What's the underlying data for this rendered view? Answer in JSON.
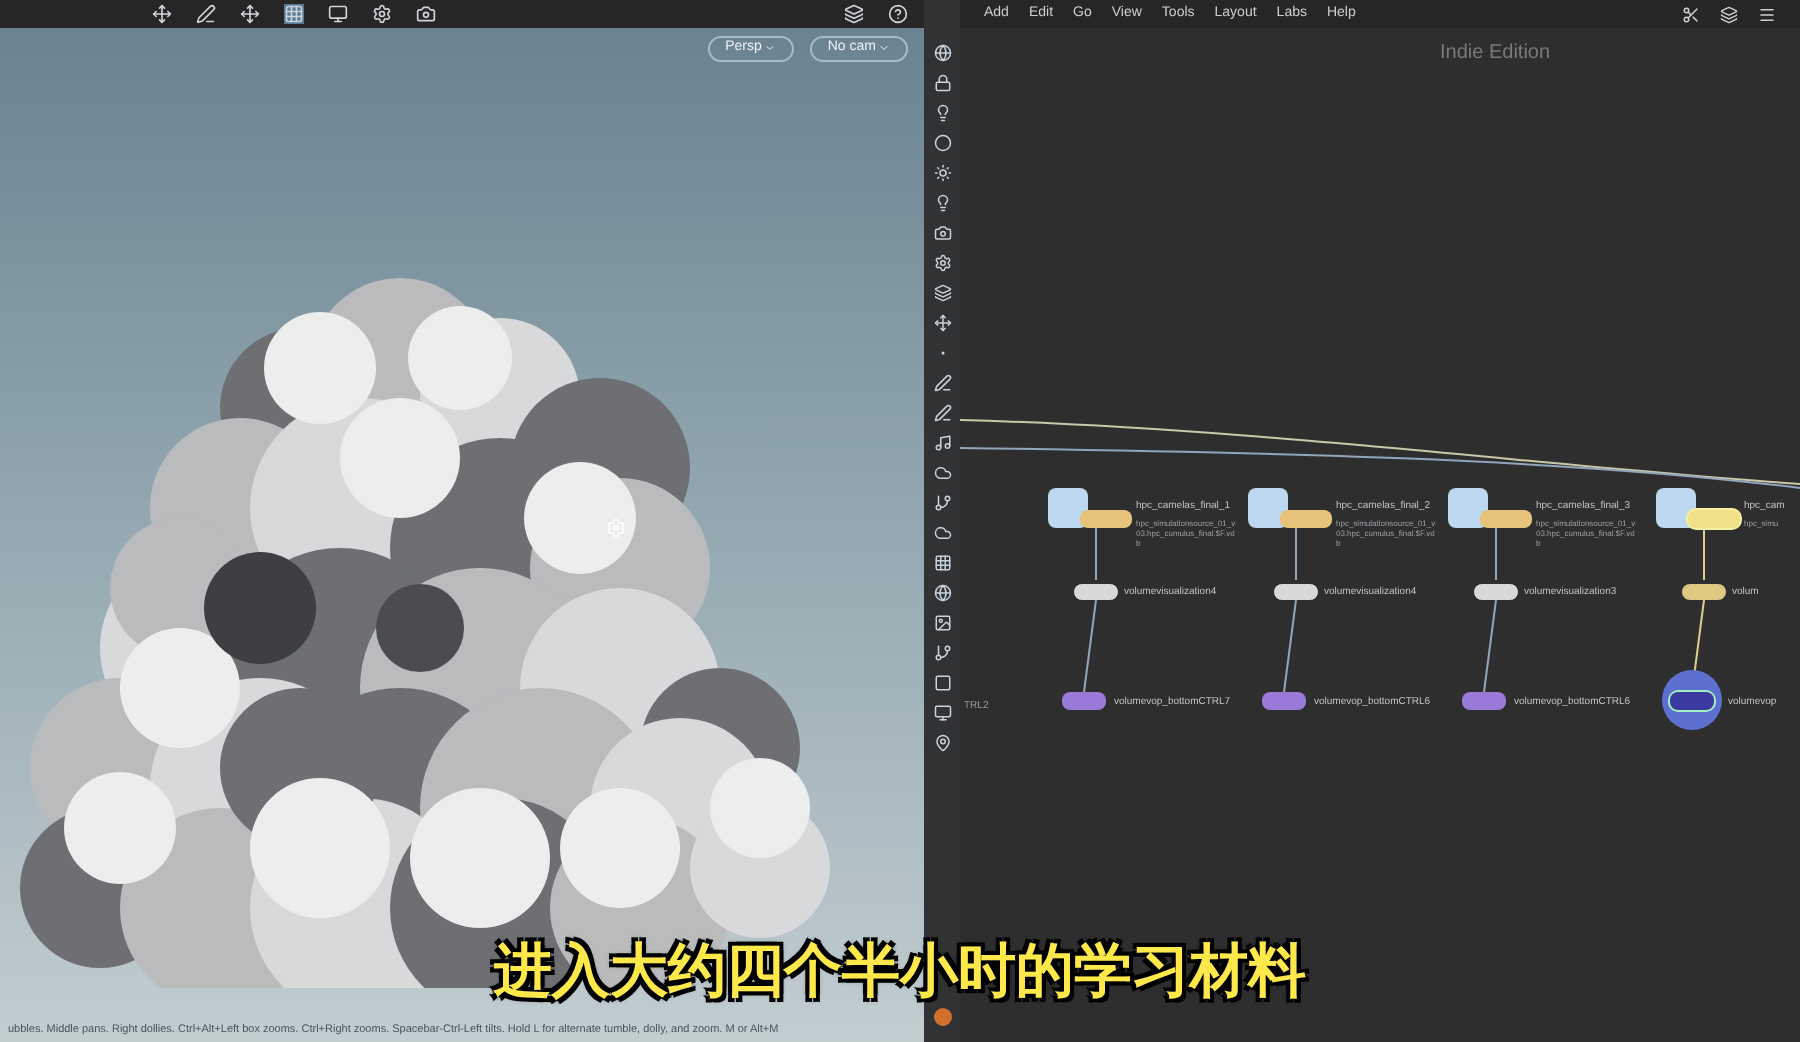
{
  "viewport": {
    "view_menus": [
      "Persp",
      "No cam"
    ],
    "status_bar": "ubbles. Middle pans. Right dollies. Ctrl+Alt+Left box zooms. Ctrl+Right zooms. Spacebar-Ctrl-Left tilts. Hold L for alternate tumble, dolly, and zoom.    M or Alt+M"
  },
  "network": {
    "menu": [
      "Add",
      "Edit",
      "Go",
      "View",
      "Tools",
      "Layout",
      "Labs",
      "Help"
    ],
    "edition": "Indie Edition",
    "side_label": "TRL2",
    "columns": [
      {
        "file": "hpc_camelas_final_1",
        "file_path": "hpc_simulationsource_01_v03.hpc_cumulus_final.$F.vdb",
        "visualize": "volumevisualization4",
        "vop": "volumevop_bottomCTRL7",
        "selected": false
      },
      {
        "file": "hpc_camelas_final_2",
        "file_path": "hpc_simulationsource_01_v03.hpc_cumulus_final.$F.vdb",
        "visualize": "volumevisualization4",
        "vop": "volumevop_bottomCTRL6",
        "selected": false
      },
      {
        "file": "hpc_camelas_final_3",
        "file_path": "hpc_simulationsource_01_v03.hpc_cumulus_final.$F.vdb",
        "visualize": "volumevisualization3",
        "vop": "volumevop_bottomCTRL6",
        "selected": false
      },
      {
        "file": "hpc_cam",
        "file_path": "hpc_simu",
        "visualize": "volum",
        "vop": "volumevop",
        "selected": true
      }
    ]
  },
  "subtitle": "进入大约四个半小时的学习材料"
}
